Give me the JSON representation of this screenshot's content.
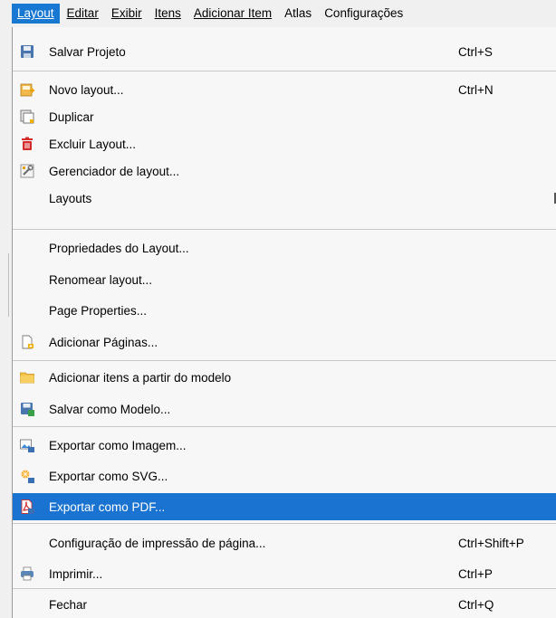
{
  "menubar": {
    "items": [
      {
        "label": "Layout",
        "active": true
      },
      {
        "label": "Editar"
      },
      {
        "label": "Exibir"
      },
      {
        "label": "Itens"
      },
      {
        "label": "Adicionar Item"
      },
      {
        "label": "Atlas"
      },
      {
        "label": "Configurações"
      }
    ]
  },
  "menu": {
    "items": [
      {
        "label": "Salvar Projeto",
        "shortcut": "Ctrl+S",
        "icon": "save-icon"
      },
      {
        "label": "Novo layout...",
        "shortcut": "Ctrl+N",
        "icon": "new-layout-icon"
      },
      {
        "label": "Duplicar",
        "shortcut": "",
        "icon": "duplicate-layout-icon"
      },
      {
        "label": "Excluir Layout...",
        "shortcut": "",
        "icon": "delete-icon"
      },
      {
        "label": "Gerenciador de layout...",
        "shortcut": "",
        "icon": "layout-manager-icon"
      },
      {
        "label": "Layouts",
        "shortcut": "",
        "icon": "",
        "submenu": true
      },
      {
        "label": "Propriedades do Layout...",
        "shortcut": "",
        "icon": ""
      },
      {
        "label": "Renomear layout...",
        "shortcut": "",
        "icon": ""
      },
      {
        "label": "Page Properties...",
        "shortcut": "",
        "icon": ""
      },
      {
        "label": "Adicionar Páginas...",
        "shortcut": "",
        "icon": "add-pages-icon"
      },
      {
        "label": "Adicionar itens a partir do modelo",
        "shortcut": "",
        "icon": "folder-icon"
      },
      {
        "label": "Salvar como Modelo...",
        "shortcut": "",
        "icon": "save-as-template-icon"
      },
      {
        "label": "Exportar como Imagem...",
        "shortcut": "",
        "icon": "export-image-icon"
      },
      {
        "label": "Exportar como SVG...",
        "shortcut": "",
        "icon": "export-svg-icon"
      },
      {
        "label": "Exportar como PDF...",
        "shortcut": "",
        "icon": "export-pdf-icon",
        "highlighted": true
      },
      {
        "label": "Configuração de impressão de página...",
        "shortcut": "Ctrl+Shift+P",
        "icon": ""
      },
      {
        "label": "Imprimir...",
        "shortcut": "Ctrl+P",
        "icon": "print-icon"
      },
      {
        "label": "Fechar",
        "shortcut": "Ctrl+Q",
        "icon": ""
      }
    ]
  },
  "colors": {
    "highlight": "#1a73d0",
    "menu_background": "#f7f7f7",
    "menubar_background": "#f0f0f0"
  }
}
